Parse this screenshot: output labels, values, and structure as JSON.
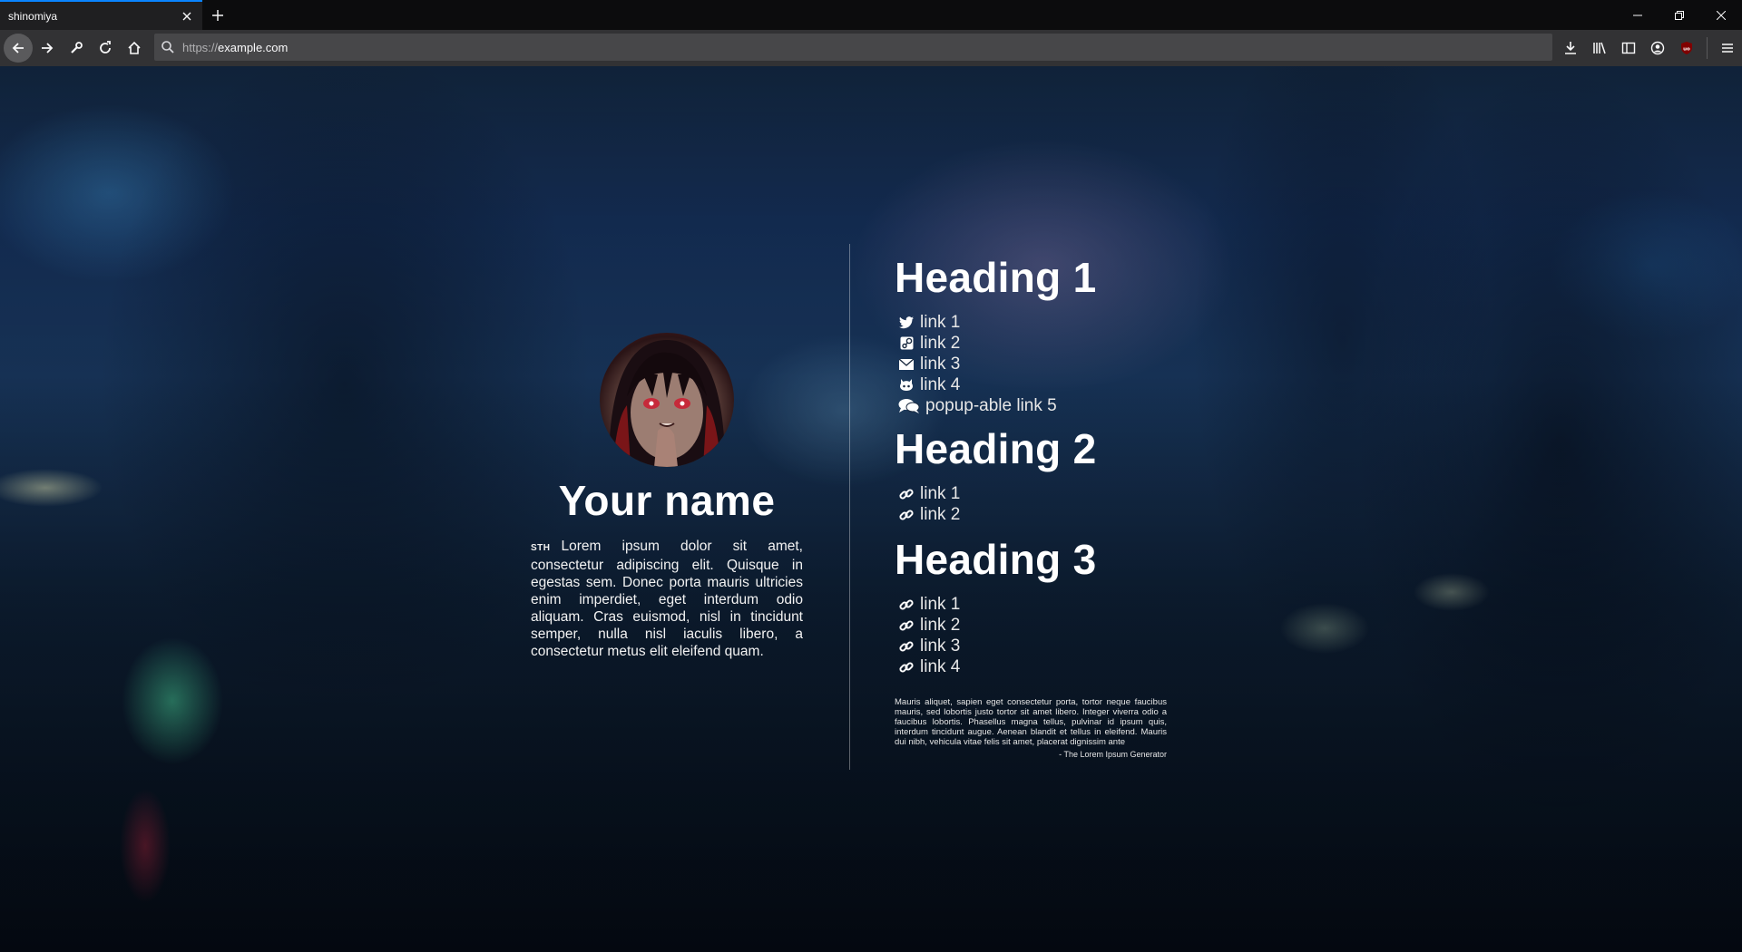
{
  "browser": {
    "tab_title": "shinomiya",
    "url_prefix": "https://",
    "url_host": "example.com"
  },
  "profile": {
    "name": "Your name",
    "bio_tag": "STH",
    "bio": "Lorem ipsum dolor sit amet, consectetur adipiscing elit. Quisque in egestas sem. Donec porta mauris ultricies enim imperdiet, eget interdum odio aliquam. Cras euismod, nisl in tincidunt semper, nulla nisl iaculis libero, a consectetur metus elit eleifend quam."
  },
  "sections": [
    {
      "heading": "Heading 1",
      "links": [
        {
          "label": "link 1",
          "icon": "twitter-icon"
        },
        {
          "label": "link 2",
          "icon": "steam-icon"
        },
        {
          "label": "link 3",
          "icon": "mail-icon"
        },
        {
          "label": "link 4",
          "icon": "github-icon"
        },
        {
          "label": "popup-able link 5",
          "icon": "chat-icon"
        }
      ]
    },
    {
      "heading": "Heading 2",
      "links": [
        {
          "label": "link 1",
          "icon": "link-icon"
        },
        {
          "label": "link 2",
          "icon": "link-icon"
        }
      ]
    },
    {
      "heading": "Heading 3",
      "links": [
        {
          "label": "link 1",
          "icon": "link-icon"
        },
        {
          "label": "link 2",
          "icon": "link-icon"
        },
        {
          "label": "link 3",
          "icon": "link-icon"
        },
        {
          "label": "link 4",
          "icon": "link-icon"
        }
      ]
    }
  ],
  "quote": {
    "text": "Mauris aliquet, sapien eget consectetur porta, tortor neque faucibus mauris, sed lobortis justo tortor sit amet libero. Integer viverra odio a faucibus lobortis. Phasellus magna tellus, pulvinar id ipsum quis, interdum tincidunt augue. Aenean blandit et tellus in eleifend. Mauris dui nibh, vehicula vitae felis sit amet, placerat dignissim ante",
    "source": "- The Lorem Ipsum Generator"
  },
  "colors": {
    "tab_accent": "#0a84ff",
    "chrome_bg": "#323234",
    "text": "#ffffff",
    "ublock_badge": "#800000"
  }
}
